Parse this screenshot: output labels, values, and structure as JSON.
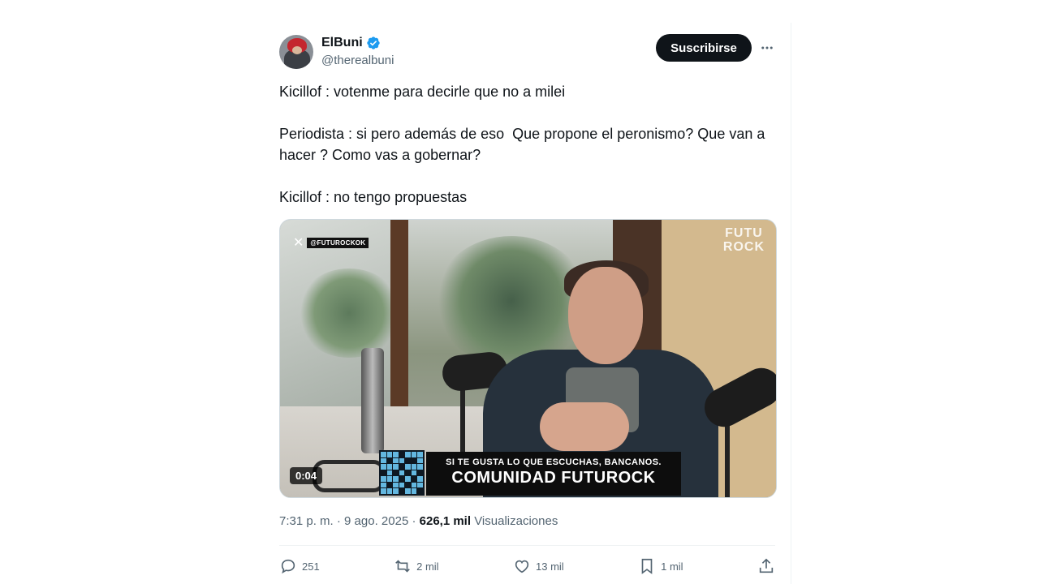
{
  "author": {
    "display_name": "ElBuni",
    "handle": "@therealbuni",
    "verified_color": "#1d9bf0"
  },
  "subscribe_label": "Suscribirse",
  "tweet": {
    "paragraphs": [
      "Kicillof : votenme para decirle que no a milei",
      "Periodista : si pero además de eso  Que propone el peronismo? Que van a hacer ? Como vas a gobernar?",
      "Kicillof : no tengo propuestas"
    ]
  },
  "media": {
    "source_tag": "@FUTUROCKOK",
    "watermark_line1": "FUTU",
    "watermark_line2": "ROCK",
    "banner_small": "SI TE GUSTA LO QUE ESCUCHAS, BANCANOS.",
    "banner_large": "COMUNIDAD FUTUROCK",
    "timestamp": "0:04"
  },
  "meta": {
    "time": "7:31 p. m.",
    "separator": " · ",
    "date": "9 ago. 2025",
    "views_count": "626,1 mil",
    "views_label": "Visualizaciones"
  },
  "actions": {
    "replies": "251",
    "reposts": "2 mil",
    "likes": "13 mil",
    "bookmarks": "1 mil"
  },
  "icons": [
    "verified-icon",
    "more-icon",
    "x-logo-icon",
    "reply-icon",
    "repost-icon",
    "like-icon",
    "bookmark-icon",
    "share-icon"
  ]
}
